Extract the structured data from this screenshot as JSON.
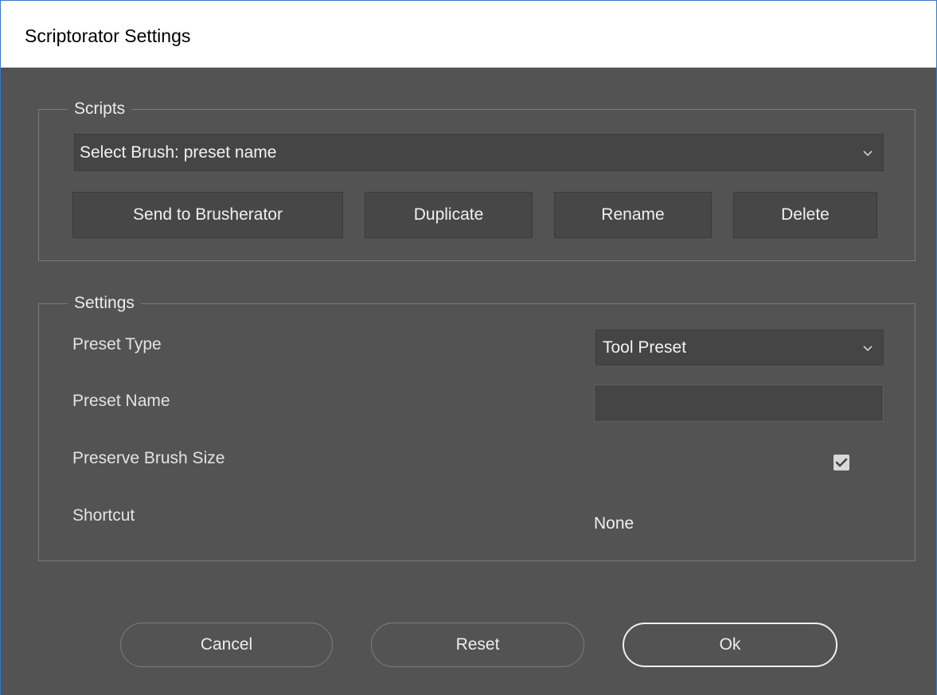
{
  "window": {
    "title": "Scriptorator Settings"
  },
  "scripts": {
    "legend": "Scripts",
    "selected_script": "Select Brush: preset name",
    "buttons": {
      "send": "Send to Brusherator",
      "duplicate": "Duplicate",
      "rename": "Rename",
      "delete": "Delete"
    }
  },
  "settings": {
    "legend": "Settings",
    "preset_type": {
      "label": "Preset Type",
      "value": "Tool Preset"
    },
    "preset_name": {
      "label": "Preset Name",
      "value": ""
    },
    "preserve_brush_size": {
      "label": "Preserve Brush Size",
      "checked": true
    },
    "shortcut": {
      "label": "Shortcut",
      "value": "None"
    }
  },
  "footer": {
    "cancel": "Cancel",
    "reset": "Reset",
    "ok": "Ok"
  },
  "icons": {
    "dropdown": "chevron-down-icon",
    "check": "check-icon"
  },
  "colors": {
    "dialog_background": "#535353",
    "control_background": "#454545",
    "text": "#ececec",
    "title_bar": "#ffffff",
    "window_border": "#3a78c8"
  }
}
